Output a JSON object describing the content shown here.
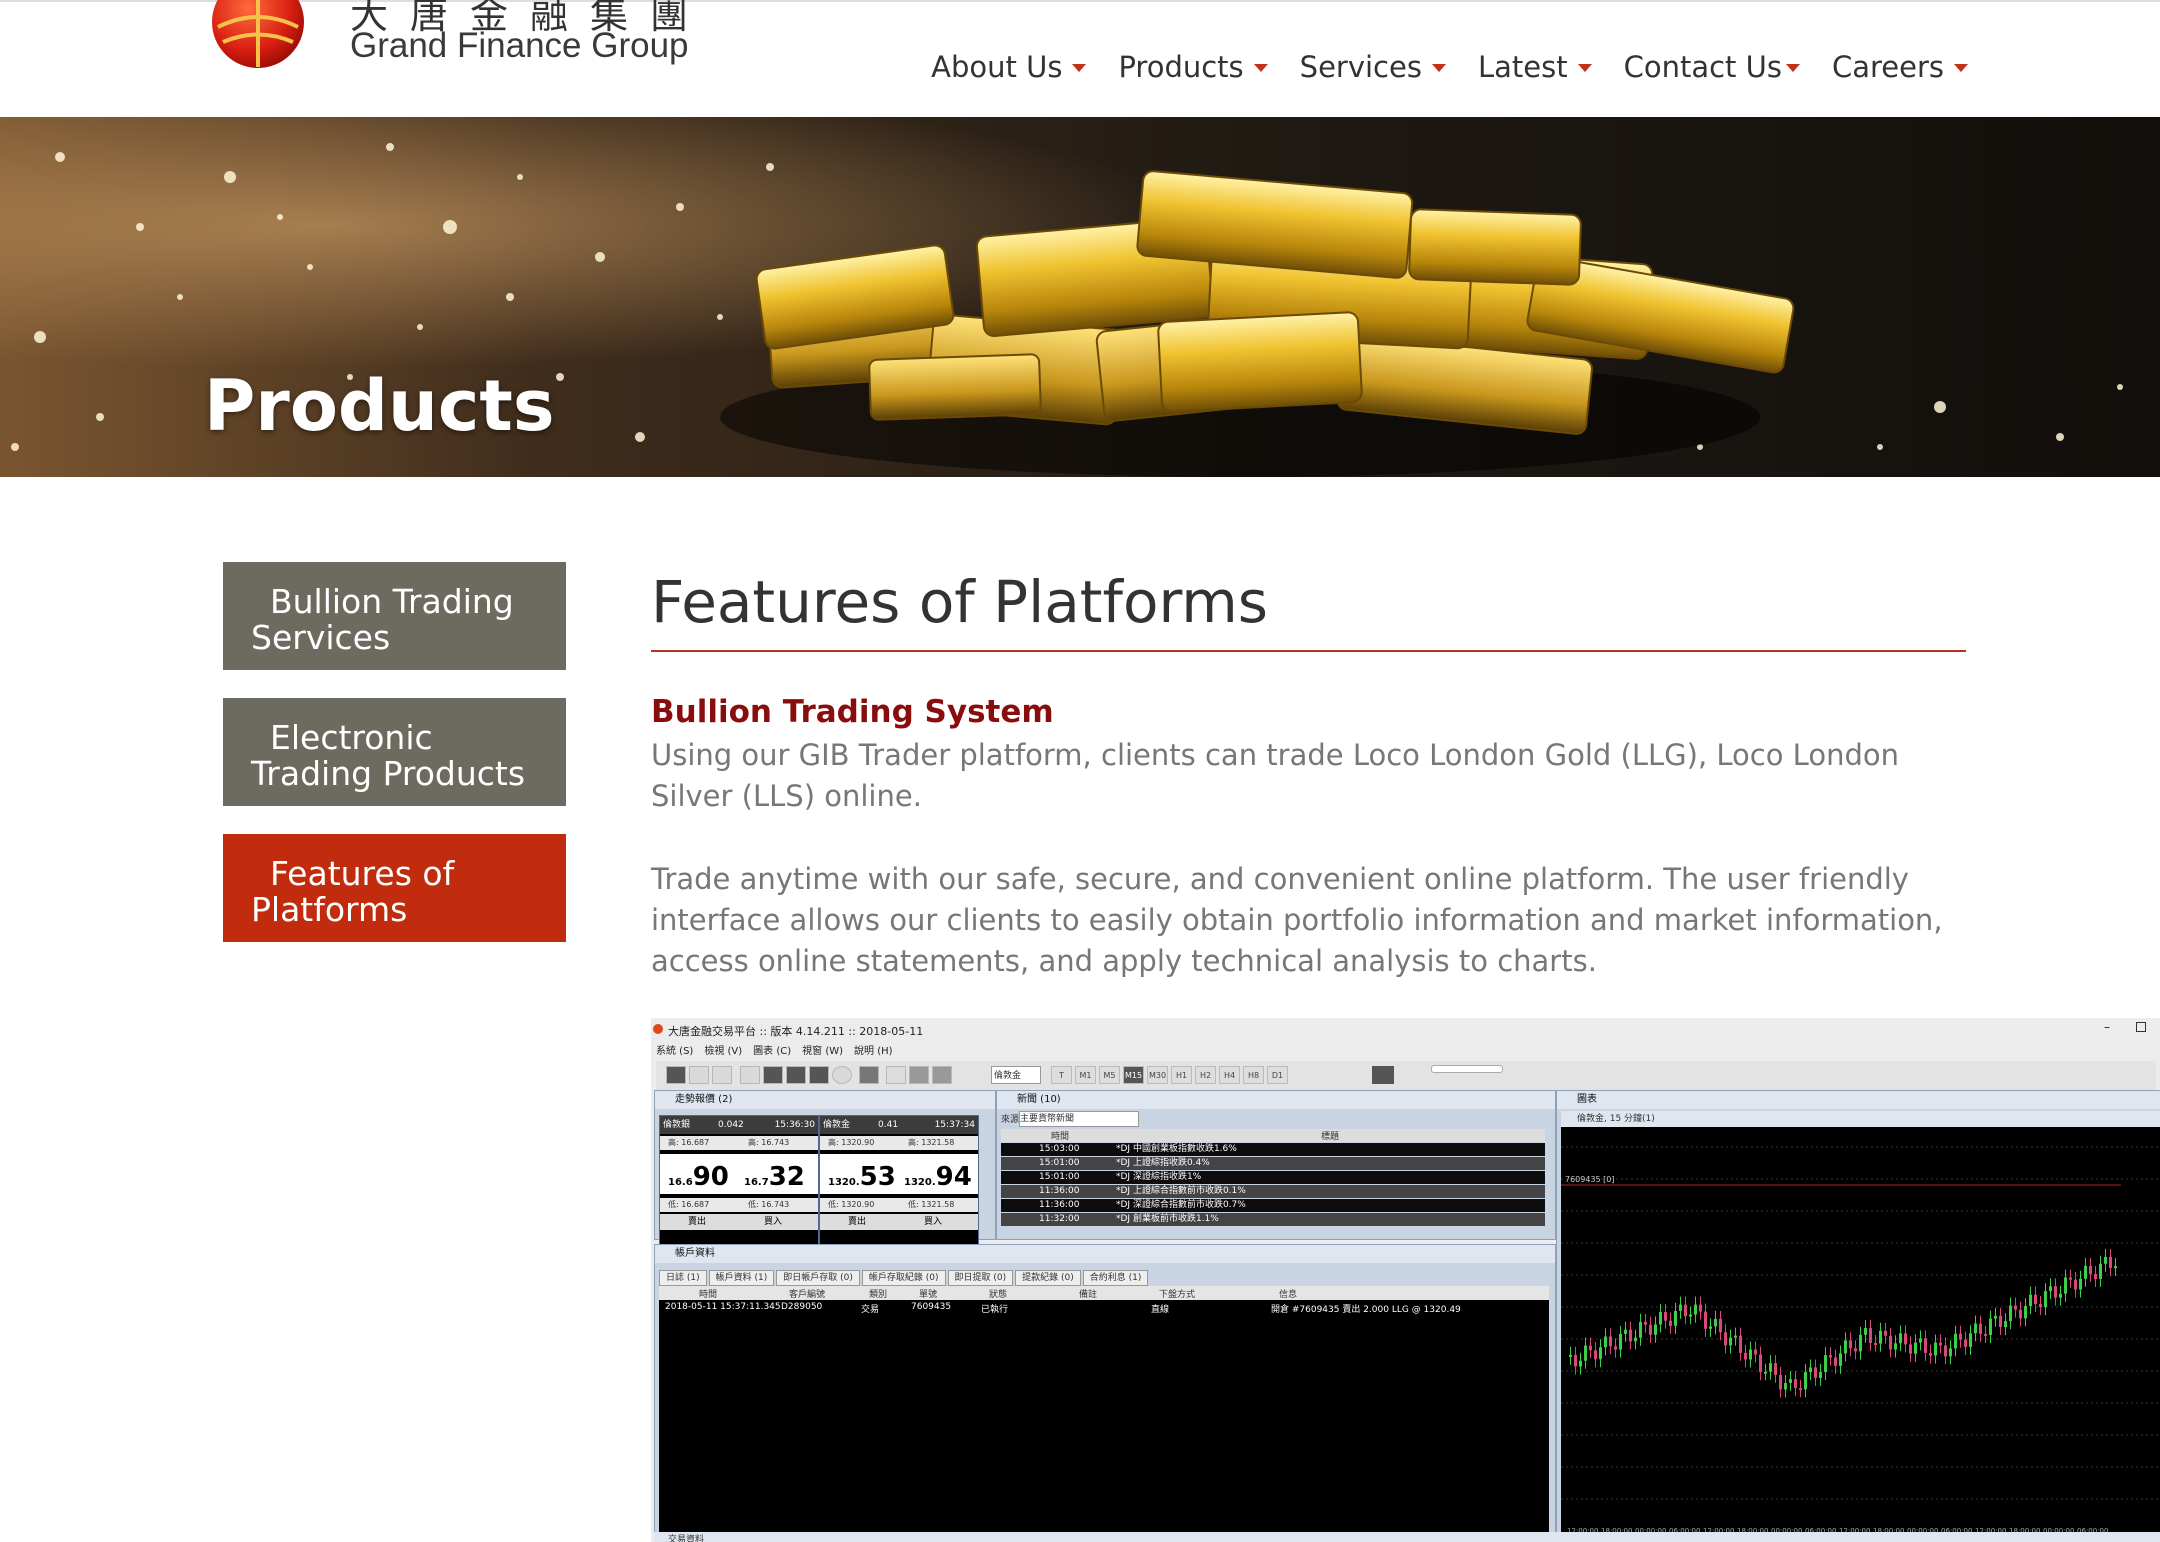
{
  "header": {
    "logo_cn": "大唐金融集團",
    "logo_en": "Grand Finance Group",
    "nav": [
      {
        "label": "About Us"
      },
      {
        "label": "Products"
      },
      {
        "label": "Services"
      },
      {
        "label": "Latest"
      },
      {
        "label": "Contact Us"
      },
      {
        "label": "Careers"
      }
    ]
  },
  "banner": {
    "title": "Products"
  },
  "sidebar": {
    "items": [
      {
        "line1": "Bullion Trading",
        "line2": "Services",
        "active": false
      },
      {
        "line1": "Electronic",
        "line2": "Trading Products",
        "active": false
      },
      {
        "line1": "Features of",
        "line2": "Platforms",
        "active": true
      }
    ]
  },
  "content": {
    "title": "Features of Platforms",
    "subhead": "Bullion Trading System",
    "para1": "Using our GIB Trader platform, clients can trade Loco London Gold (LLG), Loco London Silver (LLS) online.",
    "para2": "Trade anytime with our safe, secure, and convenient online platform. The user friendly interface allows our clients to easily obtain portfolio information and market information, access online statements, and apply technical analysis to charts."
  },
  "platform": {
    "window_title": "大唐金融交易平台 :: 版本 4.14.211 :: 2018-05-11",
    "menu": [
      "系統 (S)",
      "檢視 (V)",
      "圖表 (C)",
      "視窗 (W)",
      "說明 (H)"
    ],
    "toolbar_symbol": "倫敦金",
    "timeframes": [
      "T",
      "M1",
      "M5",
      "M15",
      "M30",
      "H1",
      "H2",
      "H4",
      "H8",
      "D1"
    ],
    "quote_panel_title": "走勢報價 (2)",
    "quotes": [
      {
        "name": "倫敦銀",
        "change": "0.042",
        "time": "15:36:30",
        "high_l": "高: 16.687",
        "high_r": "高: 16.743",
        "sell_small": "16.6",
        "sell_big": "90",
        "buy_small": "16.7",
        "buy_big": "32",
        "low_l": "低: 16.687",
        "low_r": "低: 16.743",
        "sell": "賣出",
        "buy": "買入"
      },
      {
        "name": "倫敦金",
        "change": "0.41",
        "time": "15:37:34",
        "high_l": "高: 1320.90",
        "high_r": "高: 1321.58",
        "sell_small": "1320.",
        "sell_big": "53",
        "buy_small": "1320.",
        "buy_big": "94",
        "low_l": "低: 1320.90",
        "low_r": "低: 1321.58",
        "sell": "賣出",
        "buy": "買入"
      }
    ],
    "news_title": "新聞 (10)",
    "news_source_label": "來源",
    "news_source": "主要貨幣新聞",
    "news_headers": {
      "time": "時間",
      "title": "標題"
    },
    "news": [
      {
        "time": "15:03:00",
        "title": "*DJ 中國創業板指數收跌1.6%"
      },
      {
        "time": "15:01:00",
        "title": "*DJ 上證綜指收跌0.4%"
      },
      {
        "time": "15:01:00",
        "title": "*DJ 深證綜指收跌1%"
      },
      {
        "time": "11:36:00",
        "title": "*DJ 上證綜合指數前市收跌0.1%"
      },
      {
        "time": "11:36:00",
        "title": "*DJ 深證綜合指數前市收跌0.7%"
      },
      {
        "time": "11:32:00",
        "title": "*DJ 創業板前市收跌1.1%"
      }
    ],
    "account_title": "帳戶資料",
    "account_tabs": [
      "日誌 (1)",
      "帳戶資料 (1)",
      "即日帳戶存取 (0)",
      "帳戶存取紀錄 (0)",
      "即日提取 (0)",
      "提款紀錄 (0)",
      "合約利息 (1)"
    ],
    "account_headers": [
      "時間",
      "客戶編號",
      "類別",
      "單號",
      "狀態",
      "備註",
      "下盤方式",
      "信息"
    ],
    "account_row": [
      "2018-05-11 15:37:11.345",
      "D289050",
      "交易",
      "7609435",
      "已執行",
      "",
      "直線",
      "開倉 #7609435 賣出 2.000 LLG @ 1320.49"
    ],
    "chart_title": "圖表",
    "chart_sub": "倫敦金, 15 分鐘(1)",
    "chart_order_label": "7609435 [0]",
    "chart_times": [
      "12:00:00",
      "18:00:00",
      "00:00:00",
      "06:00:00",
      "12:00:00",
      "18:00:00",
      "00:00:00",
      "06:00:00",
      "12:00:00",
      "18:00:00",
      "00:00:00",
      "06:00:00",
      "12:00:00",
      "18:00:00",
      "00:00:00",
      "06:00:00"
    ],
    "bottom_title": "交易資料"
  },
  "colors": {
    "accent": "#c02c0d",
    "subhead": "#8a0d0d",
    "sidebar_bg": "#6d6a60",
    "candle_up": "#3ecf4a",
    "candle_down": "#d64a7a"
  }
}
